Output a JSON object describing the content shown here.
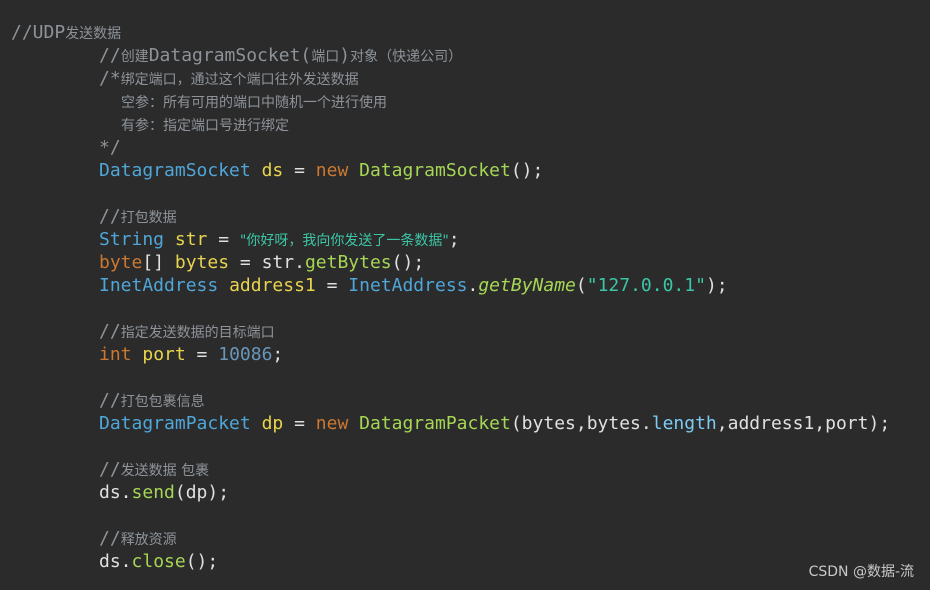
{
  "lines": [
    {
      "indent": 0,
      "tokens": [
        {
          "t": "//UDP",
          "c": "cmt"
        },
        {
          "t": "发送数据",
          "c": "cmt cmt-cn"
        }
      ]
    },
    {
      "indent": 8,
      "tokens": [
        {
          "t": "//",
          "c": "cmt"
        },
        {
          "t": "创建",
          "c": "cmt cmt-cn"
        },
        {
          "t": "DatagramSocket(",
          "c": "cmt"
        },
        {
          "t": "端口",
          "c": "cmt cmt-cn"
        },
        {
          "t": ")",
          "c": "cmt"
        },
        {
          "t": "对象（快递公司）",
          "c": "cmt cmt-cn"
        }
      ]
    },
    {
      "indent": 8,
      "tokens": [
        {
          "t": "/*",
          "c": "cmt"
        },
        {
          "t": "绑定端口，通过这个端口往外发送数据",
          "c": "cmt cmt-cn"
        }
      ]
    },
    {
      "indent": 10,
      "tokens": [
        {
          "t": "空参：所有可用的端口中随机一个进行使用",
          "c": "cmt cmt-cn"
        }
      ]
    },
    {
      "indent": 10,
      "tokens": [
        {
          "t": "有参：指定端口号进行绑定",
          "c": "cmt cmt-cn"
        }
      ]
    },
    {
      "indent": 8,
      "tokens": [
        {
          "t": "*/",
          "c": "cmt"
        }
      ]
    },
    {
      "indent": 8,
      "tokens": [
        {
          "t": "DatagramSocket",
          "c": "type"
        },
        {
          "t": " ",
          "c": "op"
        },
        {
          "t": "ds",
          "c": "var"
        },
        {
          "t": " = ",
          "c": "op"
        },
        {
          "t": "new",
          "c": "kw"
        },
        {
          "t": " ",
          "c": "op"
        },
        {
          "t": "DatagramSocket",
          "c": "fn"
        },
        {
          "t": "();",
          "c": "op"
        }
      ]
    },
    {
      "indent": 0,
      "tokens": []
    },
    {
      "indent": 8,
      "tokens": [
        {
          "t": "//",
          "c": "cmt"
        },
        {
          "t": "打包数据",
          "c": "cmt cmt-cn"
        }
      ]
    },
    {
      "indent": 8,
      "tokens": [
        {
          "t": "String",
          "c": "type"
        },
        {
          "t": " ",
          "c": "op"
        },
        {
          "t": "str",
          "c": "var"
        },
        {
          "t": " = ",
          "c": "op"
        },
        {
          "t": "\"你好呀，我向你发送了一条数据\"",
          "c": "str cmt-cn"
        },
        {
          "t": ";",
          "c": "op"
        }
      ]
    },
    {
      "indent": 8,
      "tokens": [
        {
          "t": "byte",
          "c": "kw"
        },
        {
          "t": "[] ",
          "c": "op"
        },
        {
          "t": "bytes",
          "c": "var"
        },
        {
          "t": " = ",
          "c": "op"
        },
        {
          "t": "str.",
          "c": "op"
        },
        {
          "t": "getBytes",
          "c": "fn"
        },
        {
          "t": "();",
          "c": "op"
        }
      ]
    },
    {
      "indent": 8,
      "tokens": [
        {
          "t": "InetAddress",
          "c": "type"
        },
        {
          "t": " ",
          "c": "op"
        },
        {
          "t": "address1",
          "c": "var"
        },
        {
          "t": " = ",
          "c": "op"
        },
        {
          "t": "InetAddress",
          "c": "type"
        },
        {
          "t": ".",
          "c": "op"
        },
        {
          "t": "getByName",
          "c": "stat"
        },
        {
          "t": "(",
          "c": "op"
        },
        {
          "t": "\"127.0.0.1\"",
          "c": "str"
        },
        {
          "t": ");",
          "c": "op"
        }
      ]
    },
    {
      "indent": 0,
      "tokens": []
    },
    {
      "indent": 8,
      "tokens": [
        {
          "t": "//",
          "c": "cmt"
        },
        {
          "t": "指定发送数据的目标端口",
          "c": "cmt cmt-cn"
        }
      ]
    },
    {
      "indent": 8,
      "tokens": [
        {
          "t": "int",
          "c": "kw"
        },
        {
          "t": " ",
          "c": "op"
        },
        {
          "t": "port",
          "c": "var"
        },
        {
          "t": " = ",
          "c": "op"
        },
        {
          "t": "10086",
          "c": "num"
        },
        {
          "t": ";",
          "c": "op"
        }
      ]
    },
    {
      "indent": 0,
      "tokens": []
    },
    {
      "indent": 8,
      "tokens": [
        {
          "t": "//",
          "c": "cmt"
        },
        {
          "t": "打包包裹信息",
          "c": "cmt cmt-cn"
        }
      ]
    },
    {
      "indent": 8,
      "tokens": [
        {
          "t": "DatagramPacket",
          "c": "type"
        },
        {
          "t": " ",
          "c": "op"
        },
        {
          "t": "dp",
          "c": "var"
        },
        {
          "t": " = ",
          "c": "op"
        },
        {
          "t": "new",
          "c": "kw"
        },
        {
          "t": " ",
          "c": "op"
        },
        {
          "t": "DatagramPacket",
          "c": "fn"
        },
        {
          "t": "(bytes,bytes.",
          "c": "op"
        },
        {
          "t": "length",
          "c": "fld"
        },
        {
          "t": ",address1,port);",
          "c": "op"
        }
      ]
    },
    {
      "indent": 0,
      "tokens": []
    },
    {
      "indent": 8,
      "tokens": [
        {
          "t": "//",
          "c": "cmt"
        },
        {
          "t": "发送数据 包裹",
          "c": "cmt cmt-cn"
        }
      ]
    },
    {
      "indent": 8,
      "tokens": [
        {
          "t": "ds.",
          "c": "op"
        },
        {
          "t": "send",
          "c": "fn"
        },
        {
          "t": "(dp);",
          "c": "op"
        }
      ]
    },
    {
      "indent": 0,
      "tokens": []
    },
    {
      "indent": 8,
      "tokens": [
        {
          "t": "//",
          "c": "cmt"
        },
        {
          "t": "释放资源",
          "c": "cmt cmt-cn"
        }
      ]
    },
    {
      "indent": 8,
      "tokens": [
        {
          "t": "ds.",
          "c": "op"
        },
        {
          "t": "close",
          "c": "fn"
        },
        {
          "t": "();",
          "c": "op"
        }
      ]
    }
  ],
  "watermark": "CSDN @数据-流"
}
